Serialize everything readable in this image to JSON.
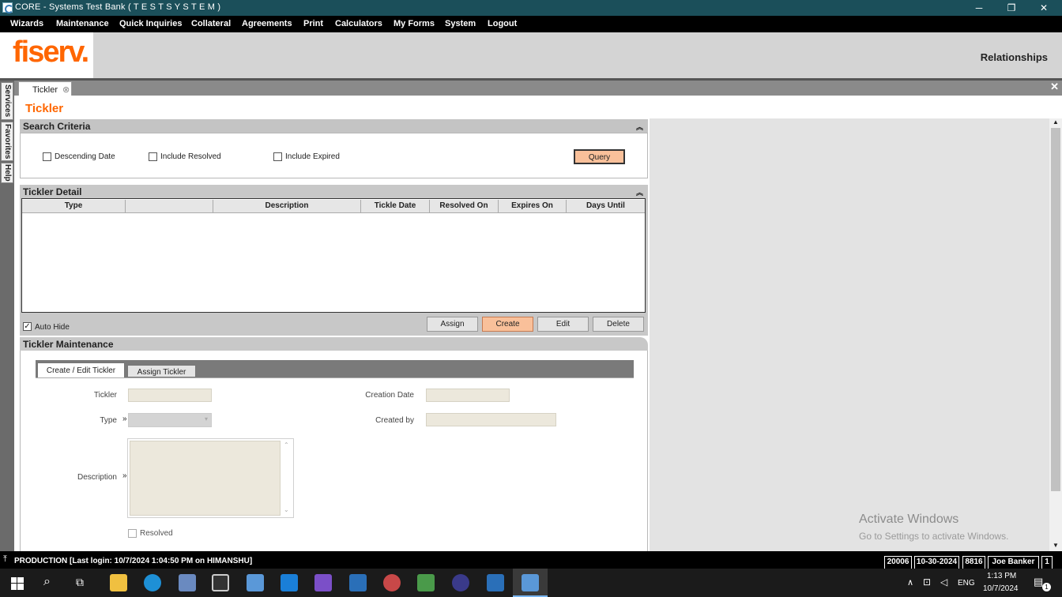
{
  "window": {
    "title": "CORE - Systems Test Bank ( T E S T   S Y S T E M )",
    "minimize": "─",
    "restore": "❐",
    "close": "✕"
  },
  "menu": [
    "Wizards",
    "Maintenance",
    "Quick Inquiries",
    "Collateral",
    "Agreements",
    "Print",
    "Calculators",
    "My Forms",
    "System",
    "Logout"
  ],
  "banner": {
    "logo": "fiserv.",
    "context": "Relationships"
  },
  "side_tabs": [
    "Services",
    "Favorites",
    "Help"
  ],
  "tabs": {
    "open_tab": "Tickler",
    "close_symbol": "⊗",
    "close_all": "✕"
  },
  "page": {
    "title": "Tickler"
  },
  "search": {
    "header": "Search Criteria",
    "collapse": "︽",
    "options": [
      "Descending Date",
      "Include Resolved",
      "Include Expired"
    ],
    "query_button": "Query"
  },
  "detail": {
    "header": "Tickler Detail",
    "collapse": "︽",
    "columns": [
      "Type",
      "",
      "Description",
      "Tickle Date",
      "Resolved On",
      "Expires On",
      "Days Until"
    ],
    "auto_hide_label": "Auto Hide",
    "auto_hide_checked": true,
    "buttons": [
      "Assign",
      "Create",
      "Edit",
      "Delete"
    ]
  },
  "maintenance": {
    "header": "Tickler Maintenance",
    "tabs": [
      "Create / Edit Tickler",
      "Assign Tickler"
    ],
    "fields": {
      "tickler": "Tickler",
      "type": "Type",
      "description": "Description",
      "creation_date": "Creation Date",
      "created_by": "Created by",
      "resolved": "Resolved"
    },
    "required_marker": "»"
  },
  "status": {
    "env": "PRODUCTION",
    "last_login": "[Last login: 10/7/2024 1:04:50 PM on HIMANSHU]",
    "cells": [
      "20006",
      "10-30-2024",
      "8816",
      "Joe Banker",
      "1"
    ]
  },
  "watermark": {
    "title": "Activate Windows",
    "subtitle": "Go to Settings to activate Windows."
  },
  "taskbar": {
    "language": "ENG",
    "time": "1:13 PM",
    "date": "10/7/2024",
    "notification_count": "1"
  }
}
